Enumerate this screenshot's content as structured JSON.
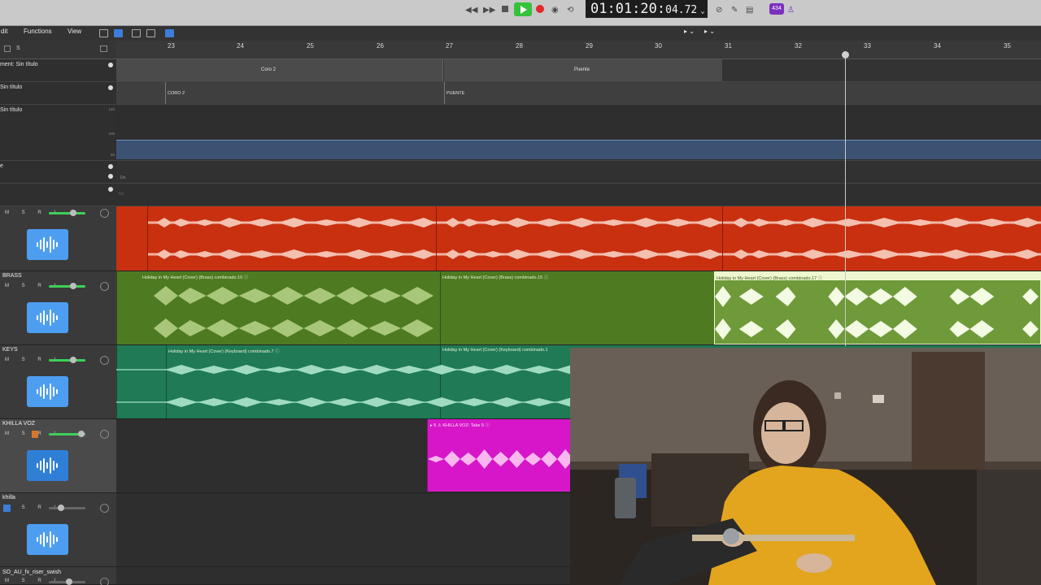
{
  "transport": {
    "timecode_main": "01:01:20:",
    "timecode_frames": "04.72",
    "badge": "434"
  },
  "menubar": {
    "edit_label": "dit",
    "functions_label": "Functions",
    "view_label": "View"
  },
  "ruler": {
    "bars": [
      "23",
      "24",
      "25",
      "26",
      "27",
      "28",
      "29",
      "30",
      "31",
      "32",
      "33",
      "34",
      "35"
    ]
  },
  "global_tracks": {
    "arrangement_label": "ment: Sin título",
    "marker_label": "Sin título",
    "tempo_label": "Sin título",
    "sig_label": "e",
    "arrangement_sections": [
      "Coro 2",
      "Puente"
    ],
    "markers": [
      "CORO 2",
      "PUENTE"
    ],
    "tempo_scale": [
      "120",
      "100",
      "80"
    ],
    "key_label_1": "Do",
    "key_label_2": "Do"
  },
  "tracks": [
    {
      "name": "",
      "controls": "M S R I"
    },
    {
      "name": "BRASS",
      "controls": "M S R I"
    },
    {
      "name": "KEYS",
      "controls": "M S R I"
    },
    {
      "name": "KHILLA VOZ",
      "controls": "M S R I"
    },
    {
      "name": "khilla",
      "controls": "M S R I"
    },
    {
      "name": "SO_AU_fx_riser_swish",
      "controls": "M S R I"
    }
  ],
  "regions": {
    "brass_1": "Holiday in My Heart (Cover) (Brass) combinado.10  ⓘ",
    "brass_2": "Holiday in My Heart (Cover) (Brass) combinado.15  ⓘ",
    "brass_3": "Holiday in My Heart (Cover) (Brass) combinado.17  ⓘ",
    "keys_1": "Holiday in My Heart (Cover) (Keyboard) combinado.7  ⓘ",
    "keys_2": "Holiday in My Heart (Cover) (Keyboard) combinado.1",
    "voz_1": "▸ 5  ⚠ KHILLA VOZ: Take 5  ⓘ"
  },
  "colors": {
    "red_track": "#c8300f",
    "brass_green": "#4e7a22",
    "keys_teal": "#1f7a55",
    "voz_magenta": "#d616c8",
    "icon_blue": "#4d9ef0"
  }
}
